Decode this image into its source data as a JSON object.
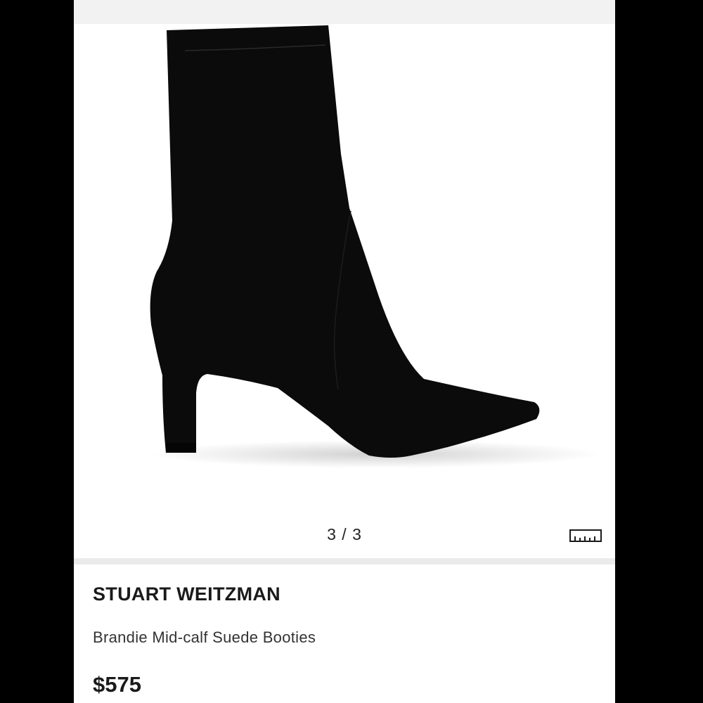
{
  "colors": {
    "background": "#000000",
    "surface": "#ffffff",
    "product": "#0b0b0b"
  },
  "gallery": {
    "image_subject": "black suede mid-calf booty",
    "pager_text": "3 / 3",
    "size_guide_icon": "ruler-icon"
  },
  "product": {
    "brand": "STUART WEITZMAN",
    "name": "Brandie Mid-calf Suede Booties",
    "price": "$575"
  }
}
